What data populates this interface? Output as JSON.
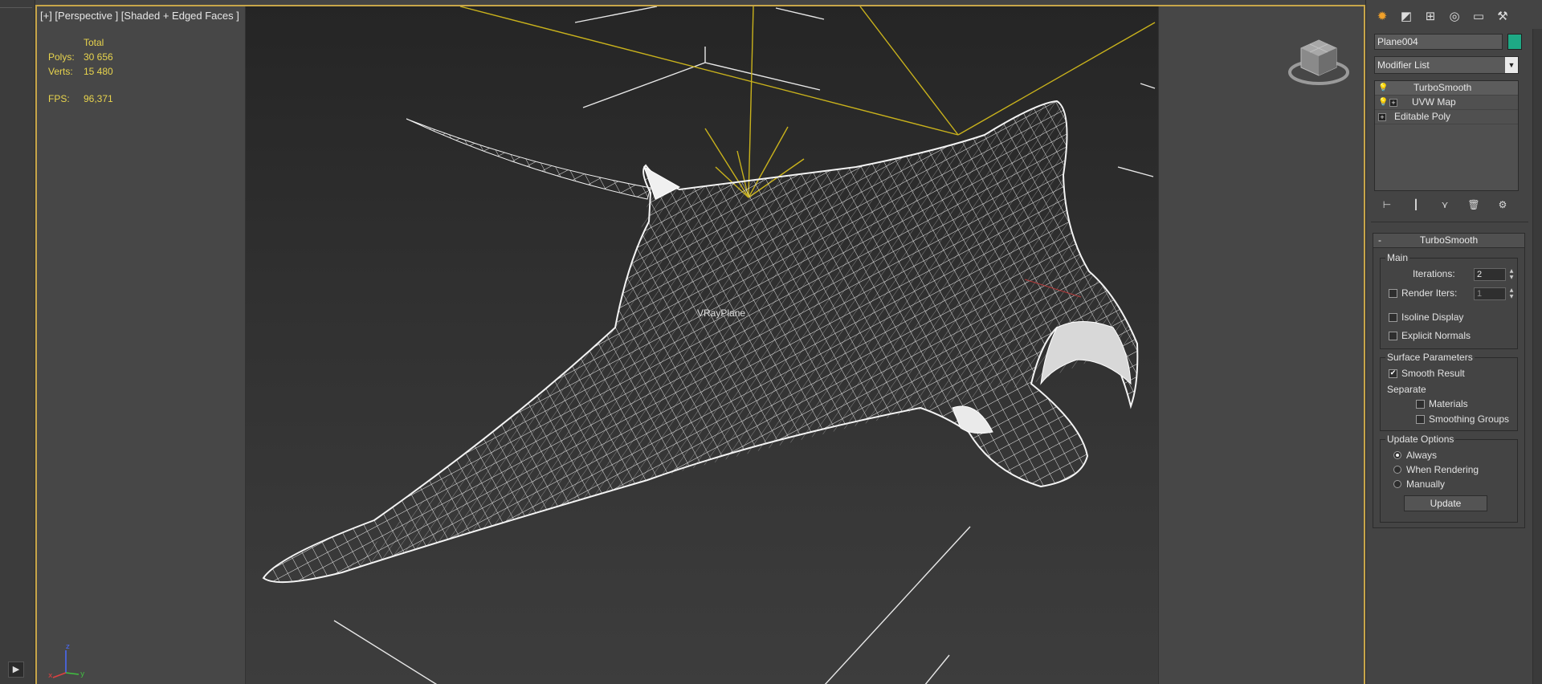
{
  "viewport": {
    "label": "[+] [Perspective ] [Shaded + Edged Faces ]",
    "stats": {
      "header": "Total",
      "polys_label": "Polys:",
      "polys_value": "30 656",
      "verts_label": "Verts:",
      "verts_value": "15 480",
      "fps_label": "FPS:",
      "fps_value": "96,371"
    },
    "object_label": "VRayPlane",
    "axis_labels": {
      "z": "z",
      "x": "x",
      "y": "y"
    }
  },
  "panel": {
    "tabs": [
      {
        "icon": "create-icon"
      },
      {
        "icon": "modify-icon"
      },
      {
        "icon": "hierarchy-icon"
      },
      {
        "icon": "motion-icon"
      },
      {
        "icon": "display-icon"
      },
      {
        "icon": "utilities-icon"
      }
    ],
    "object_name": "Plane004",
    "object_color": "#1ea985",
    "modifier_list": "Modifier List",
    "stack": [
      {
        "label": "TurboSmooth",
        "selected": true
      },
      {
        "label": "UVW Map",
        "selected": false
      },
      {
        "label": "Editable Poly",
        "selected": false
      }
    ],
    "rollout": {
      "title": "TurboSmooth",
      "collapse": "-",
      "main": {
        "title": "Main",
        "iterations_label": "Iterations:",
        "iterations_value": "2",
        "render_iters_label": "Render Iters:",
        "render_iters_value": "1",
        "isoline_label": "Isoline Display",
        "explicit_normals_label": "Explicit Normals"
      },
      "surface": {
        "title": "Surface Parameters",
        "smooth_result_label": "Smooth Result",
        "separate_label": "Separate",
        "materials_label": "Materials",
        "smoothing_groups_label": "Smoothing Groups"
      },
      "update": {
        "title": "Update Options",
        "always_label": "Always",
        "when_rendering_label": "When Rendering",
        "manually_label": "Manually",
        "button_label": "Update"
      }
    }
  },
  "colors": {
    "viewport_border": "#c8a64a",
    "stats_text": "#e8d44d",
    "active_tab": "#f1a12a",
    "light_lines": "#c9b21c"
  }
}
